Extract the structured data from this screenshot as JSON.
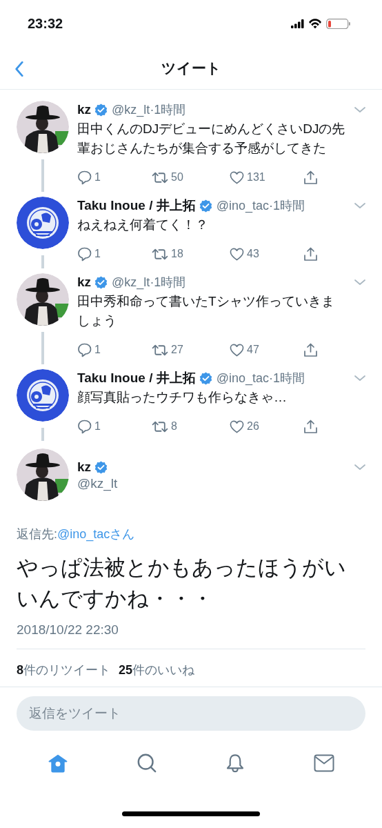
{
  "status_bar": {
    "time": "23:32"
  },
  "nav": {
    "title": "ツイート"
  },
  "thread": [
    {
      "author": "kz",
      "verified": true,
      "handle": "@kz_lt",
      "time": "·1時間",
      "text": "田中くんのDJデビューにめんどくさいDJの先輩おじさんたちが集合する予感がしてきた",
      "replies": "1",
      "retweets": "50",
      "likes": "131"
    },
    {
      "author": "Taku Inoue / 井上拓",
      "verified": true,
      "handle": "@ino_tac",
      "time": "·1時間",
      "text": "ねえねえ何着てく！？",
      "replies": "1",
      "retweets": "18",
      "likes": "43"
    },
    {
      "author": "kz",
      "verified": true,
      "handle": "@kz_lt",
      "time": "·1時間",
      "text": "田中秀和命って書いたTシャツ作っていきましょう",
      "replies": "1",
      "retweets": "27",
      "likes": "47"
    },
    {
      "author": "Taku Inoue / 井上拓",
      "verified": true,
      "handle": "@ino_tac",
      "time": "·1時間",
      "text": "顔写真貼ったウチワも作らなきゃ…",
      "replies": "1",
      "retweets": "8",
      "likes": "26"
    }
  ],
  "main_tweet": {
    "author": "kz",
    "verified": true,
    "handle": "@kz_lt",
    "reply_to_label": "返信先:",
    "reply_to": "@ino_tacさん",
    "text": "やっぱ法被とかもあったほうがいいんですかね・・・",
    "date": "2018/10/22 22:30",
    "retweet_count": "**8**件のリツイート",
    "like_count": "**25**件のいいね"
  },
  "reply_field": {
    "placeholder": "返信をツイート"
  },
  "tab_bar": [
    {
      "kind": "home",
      "selected": true
    },
    {
      "kind": "search",
      "selected": false
    },
    {
      "kind": "notifications",
      "selected": false
    },
    {
      "kind": "messages",
      "selected": false
    }
  ]
}
